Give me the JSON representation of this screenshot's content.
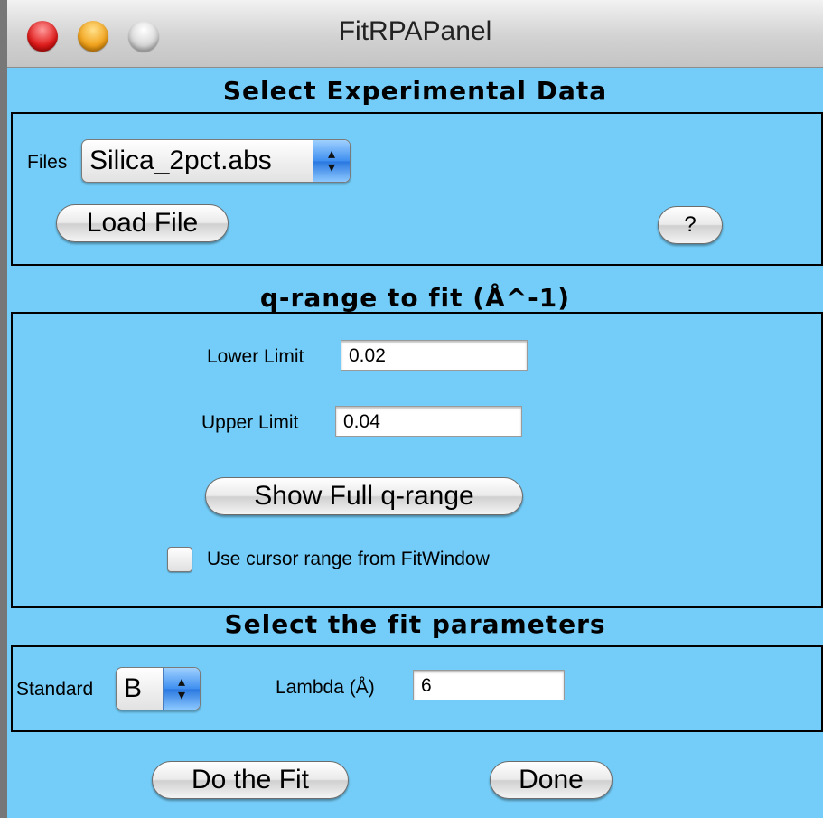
{
  "window": {
    "title": "FitRPAPanel"
  },
  "data_section": {
    "title": "Select Experimental Data",
    "files_label": "Files",
    "files_value": "Silica_2pct.abs",
    "load_button": "Load File",
    "help_button": "?"
  },
  "qrange_section": {
    "title": "q-range to fit (Å^-1)",
    "lower_label": "Lower Limit",
    "lower_value": "0.02",
    "upper_label": "Upper Limit",
    "upper_value": "0.04",
    "full_range_button": "Show Full q-range",
    "cursor_checkbox_label": "Use cursor range from FitWindow",
    "cursor_checkbox_checked": false
  },
  "params_section": {
    "title": "Select the fit parameters",
    "standard_label": "Standard",
    "standard_value": "B",
    "lambda_label": "Lambda (Å)",
    "lambda_value": "6"
  },
  "actions": {
    "fit_button": "Do the Fit",
    "done_button": "Done"
  },
  "colors": {
    "panel_bg": "#74CDF8"
  }
}
